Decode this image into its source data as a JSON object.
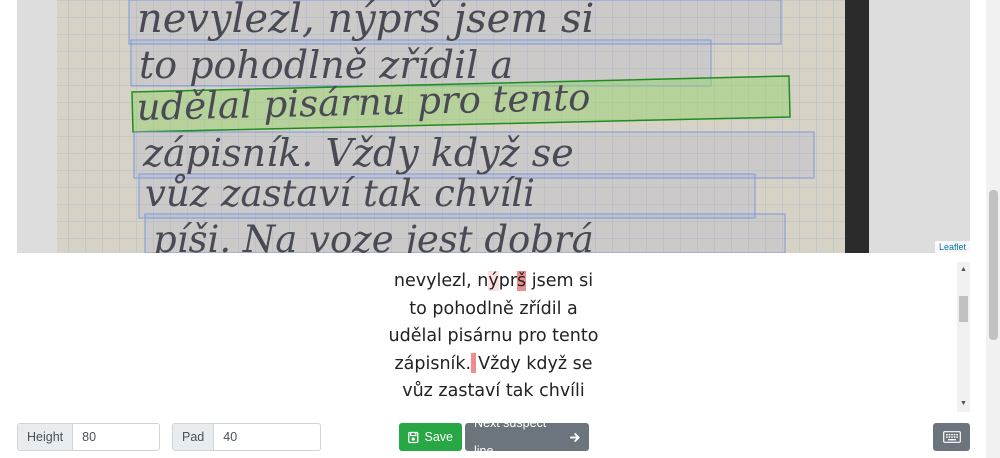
{
  "map": {
    "attribution": "Leaflet",
    "handwriting": [
      "nevylezl, nýprš jsem si",
      "to pohodlně zřídil a",
      "udělal pisárnu pro tento",
      "zápisník. Vždy když se",
      "vůz zastaví tak chvíli",
      "píši. Na voze jest dobrá"
    ]
  },
  "transcript": {
    "lines": [
      {
        "parts": [
          {
            "t": "nevylezl, n"
          },
          {
            "t": "ý",
            "c": "hl-faint"
          },
          {
            "t": "pr"
          },
          {
            "t": "š",
            "c": "hl-strong"
          },
          {
            "t": " jsem si"
          }
        ]
      },
      {
        "parts": [
          {
            "t": "to pohodlně zřídil a"
          }
        ]
      },
      {
        "parts": [
          {
            "t": "udělal pisárnu pro tento"
          }
        ]
      },
      {
        "parts": [
          {
            "t": "zápisník."
          },
          {
            "t": " ",
            "c": "mark"
          },
          {
            "t": "Vždy když se"
          }
        ]
      },
      {
        "parts": [
          {
            "t": "vůz zastaví tak chvíli"
          }
        ]
      }
    ]
  },
  "controls": {
    "height_label": "Height",
    "height_value": "80",
    "pad_label": "Pad",
    "pad_value": "40",
    "save_label": "Save",
    "next_label": "Next suspect line"
  },
  "colors": {
    "save": "#28a745",
    "secondary": "#6c757d",
    "active_line": "#1f8c1f"
  }
}
